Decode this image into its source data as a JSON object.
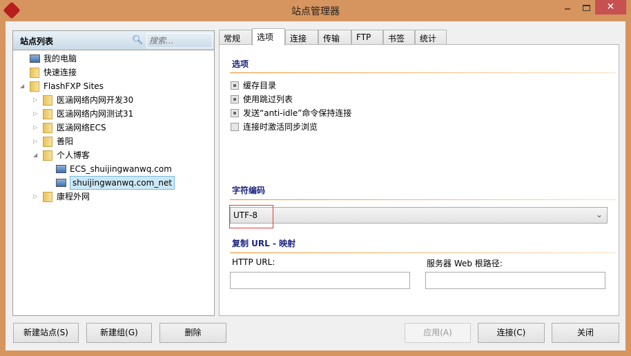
{
  "window": {
    "title": "站点管理器",
    "close": "✕"
  },
  "sidebar": {
    "title": "站点列表",
    "search_placeholder": "搜索...",
    "tree": [
      {
        "label": "我的电脑",
        "type": "pc"
      },
      {
        "label": "快速连接",
        "type": "folder"
      },
      {
        "label": "FlashFXP Sites",
        "type": "folder",
        "expanded": true
      },
      {
        "label": "医涵网络内网开发30",
        "type": "folder"
      },
      {
        "label": "医涵网络内网测试31",
        "type": "folder"
      },
      {
        "label": "医涵网络ECS",
        "type": "folder"
      },
      {
        "label": "善阳",
        "type": "folder"
      },
      {
        "label": "个人博客",
        "type": "folder",
        "expanded": true
      },
      {
        "label": "ECS_shuijingwanwq.com",
        "type": "site"
      },
      {
        "label": "shuijingwanwq.com_net",
        "type": "site",
        "selected": true
      },
      {
        "label": "康程外网",
        "type": "folder"
      }
    ]
  },
  "tabs": [
    "常规",
    "选项",
    "连接",
    "传输",
    "FTP",
    "书签",
    "统计"
  ],
  "options": {
    "section": "选项",
    "checkboxes": [
      {
        "label": "缓存目录",
        "checked": true
      },
      {
        "label": "使用跳过列表",
        "checked": true
      },
      {
        "label": "发送“anti-idle”命令保持连接",
        "checked": true
      },
      {
        "label": "连接时激活同步浏览",
        "checked": false
      }
    ],
    "encoding_section": "字符编码",
    "encoding_value": "UTF-8",
    "url_section": "复制 URL - 映射",
    "http_url_label": "HTTP URL:",
    "web_root_label": "服务器 Web 根路径:",
    "http_url_value": "",
    "web_root_value": ""
  },
  "buttons": {
    "new_site": "新建站点(S)",
    "new_group": "新建组(G)",
    "delete": "删除",
    "apply": "应用(A)",
    "connect": "连接(C)",
    "close": "关闭"
  }
}
